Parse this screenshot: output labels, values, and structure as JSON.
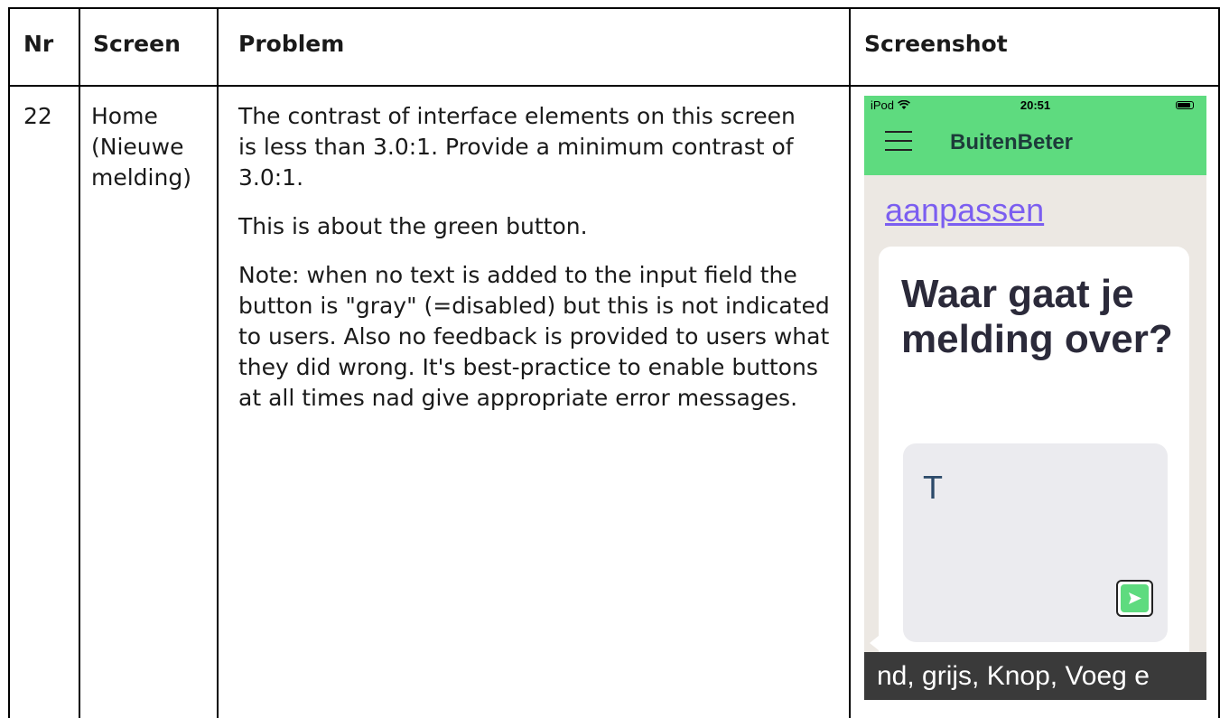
{
  "headers": {
    "nr": "Nr",
    "screen": "Screen",
    "problem": "Problem",
    "screenshot": "Screenshot"
  },
  "row": {
    "nr": "22",
    "screen_lines": [
      "Home",
      "(Nieuwe",
      "melding)"
    ],
    "problem_paragraphs": [
      "The contrast of interface elements on this screen is less than 3.0:1. Provide a minimum contrast of 3.0:1.",
      "This is about the green button.",
      "Note: when no text is added to the input field the button is \"gray\" (=disabled) but this is not indicated to users. Also no feedback is provided to users what they did wrong. It's best-practice to enable buttons at all times nad give appropriate error messages."
    ]
  },
  "phone": {
    "status_left": "iPod",
    "wifi_icon": "wifi-icon",
    "time": "20:51",
    "battery_icon": "battery-icon",
    "menu_icon": "hamburger-menu-icon",
    "app_title": "BuitenBeter",
    "link_text": "aanpassen",
    "card_title": "Waar gaat je melding over?",
    "input_value": "T",
    "send_icon": "send-arrow-icon",
    "caption": "nd, grijs, Knop, Voeg e",
    "colors": {
      "header_green": "#5edb7f",
      "link_purple": "#7b5ef0",
      "title_dark": "#2b2a3a"
    }
  }
}
